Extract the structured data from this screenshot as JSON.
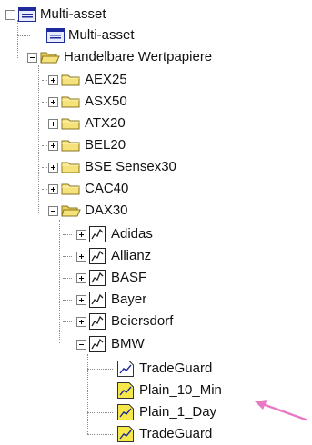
{
  "tree": {
    "root": {
      "label": "Multi-asset",
      "icon": "window-icon",
      "expanded": true
    },
    "root_child": {
      "label": "Multi-asset",
      "icon": "window-icon"
    },
    "tradable": {
      "label": "Handelbare Wertpapiere",
      "icon": "folder-open-icon",
      "expanded": true
    },
    "indices": [
      {
        "label": "AEX25",
        "icon": "folder-icon",
        "expanded": false
      },
      {
        "label": "ASX50",
        "icon": "folder-icon",
        "expanded": false
      },
      {
        "label": "ATX20",
        "icon": "folder-icon",
        "expanded": false
      },
      {
        "label": "BEL20",
        "icon": "folder-icon",
        "expanded": false
      },
      {
        "label": "BSE Sensex30",
        "icon": "folder-icon",
        "expanded": false
      },
      {
        "label": "CAC40",
        "icon": "folder-icon",
        "expanded": false
      },
      {
        "label": "DAX30",
        "icon": "folder-open-icon",
        "expanded": true
      }
    ],
    "stocks": [
      {
        "label": "Adidas",
        "icon": "chart-document-icon",
        "expanded": false
      },
      {
        "label": "Allianz",
        "icon": "chart-document-icon",
        "expanded": false
      },
      {
        "label": "BASF",
        "icon": "chart-document-icon",
        "expanded": false
      },
      {
        "label": "Bayer",
        "icon": "chart-document-icon",
        "expanded": false
      },
      {
        "label": "Beiersdorf",
        "icon": "chart-document-icon",
        "expanded": false
      },
      {
        "label": "BMW",
        "icon": "chart-document-icon",
        "expanded": true
      }
    ],
    "systems": [
      {
        "label": "TradeGuard",
        "icon": "system-white-icon"
      },
      {
        "label": "Plain_10_Min",
        "icon": "system-yellow-icon"
      },
      {
        "label": "Plain_1_Day",
        "icon": "system-yellow-icon"
      },
      {
        "label": "TradeGuard",
        "icon": "system-yellow-icon"
      }
    ]
  },
  "colors": {
    "folder": "#f5e27a",
    "folder_border": "#8a7420",
    "window_blue": "#1f2a9c",
    "annotation_arrow": "#e879c4",
    "system_yellow": "#f7e84a"
  }
}
